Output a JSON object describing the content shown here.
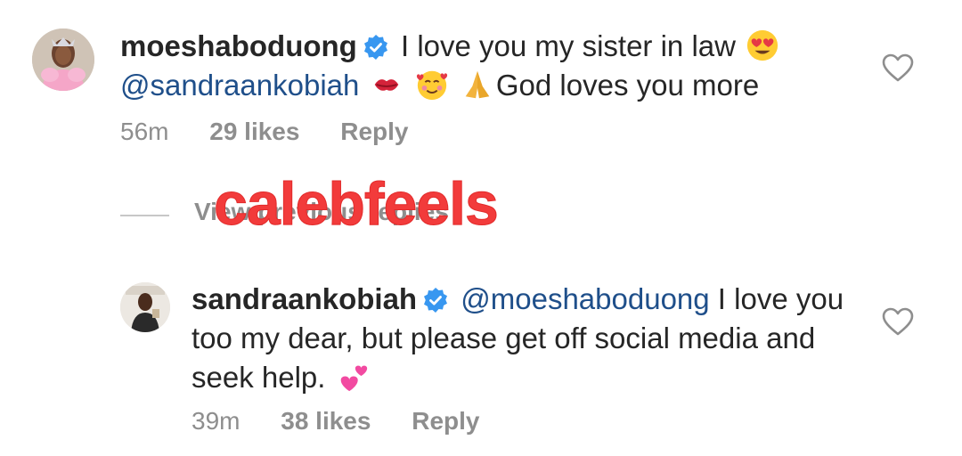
{
  "comments": [
    {
      "username": "moeshaboduong",
      "text_parts": {
        "first": "I love you my sister in law",
        "mention": "@sandraankobiah",
        "last": "God loves you more"
      },
      "emojis": [
        "heart-eyes-emoji",
        "kiss-mark-emoji",
        "smiling-face-with-hearts-emoji",
        "folded-hands-emoji"
      ],
      "time": "56m",
      "likes": "29 likes",
      "reply": "Reply"
    },
    {
      "username": "sandraankobiah",
      "text_parts": {
        "mention": "@moeshaboduong",
        "rest": "I love you too my dear, but please get off social media and seek help."
      },
      "emojis": [
        "two-hearts-emoji"
      ],
      "time": "39m",
      "likes": "38 likes",
      "reply": "Reply"
    }
  ],
  "view_replies": "View previous replies",
  "watermark": "calebfeels",
  "colors": {
    "text": "#262626",
    "mention": "#1f4f8a",
    "meta": "#8e8e8e",
    "verified": "#3897f0",
    "watermark": "#f23b3b"
  }
}
